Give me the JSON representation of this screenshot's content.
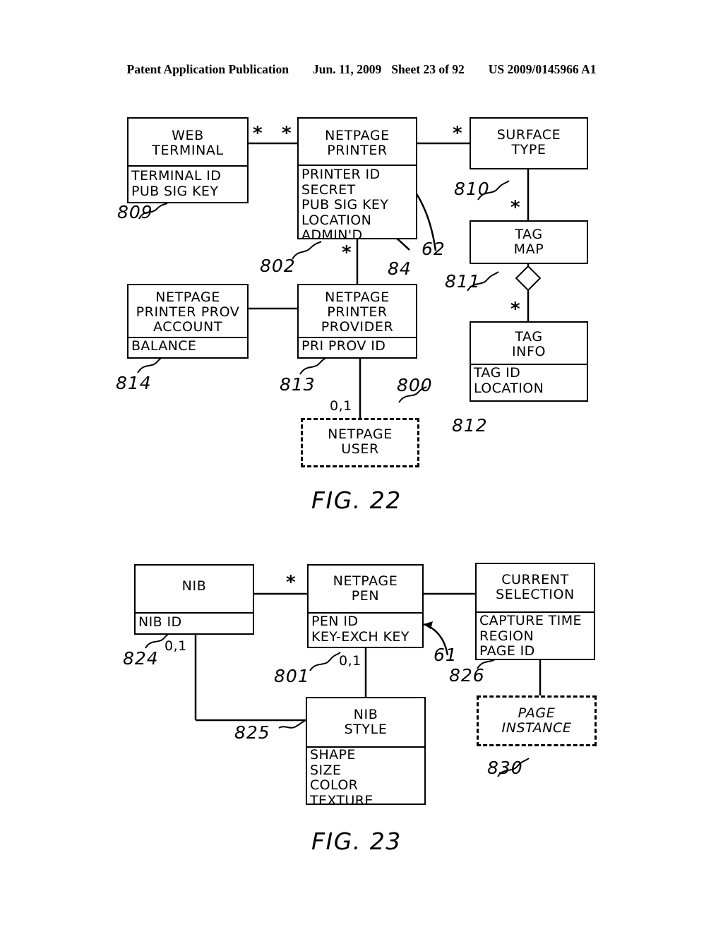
{
  "header": {
    "publication": "Patent Application Publication",
    "date": "Jun. 11, 2009",
    "sheet": "Sheet 23 of 92",
    "docnum": "US 2009/0145966 A1"
  },
  "figures": [
    {
      "caption": "FIG. 22",
      "entities": [
        {
          "id": "web-terminal",
          "title": "WEB\nTERMINAL",
          "attributes": "TERMINAL ID\nPUB SIG KEY",
          "ref": "809",
          "dashed": false
        },
        {
          "id": "netpage-printer",
          "title": "NETPAGE\nPRINTER",
          "attributes": "PRINTER ID\nSECRET\nPUB SIG KEY\nLOCATION\nADMIN'D",
          "ref": "802",
          "dashed": false
        },
        {
          "id": "surface-type",
          "title": "SURFACE\nTYPE",
          "attributes": "",
          "ref": "810",
          "dashed": false
        },
        {
          "id": "tag-map",
          "title": "TAG\nMAP",
          "attributes": "",
          "ref": "811",
          "dashed": false
        },
        {
          "id": "tag-info",
          "title": "TAG\nINFO",
          "attributes": "TAG ID\nLOCATION",
          "ref": "812",
          "dashed": false
        },
        {
          "id": "netpage-printer-prov-account",
          "title": "NETPAGE\nPRINTER PROV\nACCOUNT",
          "attributes": "BALANCE",
          "ref": "814",
          "dashed": false
        },
        {
          "id": "netpage-printer-provider",
          "title": "NETPAGE\nPRINTER\nPROVIDER",
          "attributes": "PRI PROV ID",
          "ref": "813",
          "dashed": false
        },
        {
          "id": "netpage-user",
          "title": "NETPAGE\nUSER",
          "attributes": "",
          "ref": "800",
          "dashed": true
        }
      ],
      "callouts": [
        {
          "id": "callout-62",
          "label": "62"
        },
        {
          "id": "callout-84",
          "label": "84"
        }
      ],
      "multiplicities": [
        {
          "id": "mult-webterminal-printer-left",
          "label": "*"
        },
        {
          "id": "mult-webterminal-printer-right",
          "label": "*"
        },
        {
          "id": "mult-printer-surfacetype",
          "label": "*"
        },
        {
          "id": "mult-surfacetype-tagmap",
          "label": "*"
        },
        {
          "id": "mult-tagmap-taginfo",
          "label": "*"
        },
        {
          "id": "mult-printer-provider",
          "label": "*"
        },
        {
          "id": "mult-provider-user",
          "label": "0,1"
        }
      ]
    },
    {
      "caption": "FIG. 23",
      "entities": [
        {
          "id": "nib",
          "title": "NIB",
          "attributes": "NIB ID",
          "ref": "824",
          "dashed": false
        },
        {
          "id": "netpage-pen",
          "title": "NETPAGE\nPEN",
          "attributes": "PEN ID\nKEY-EXCH KEY",
          "ref": "801",
          "dashed": false
        },
        {
          "id": "current-selection",
          "title": "CURRENT\nSELECTION",
          "attributes": "CAPTURE TIME\nREGION\nPAGE ID",
          "ref": "826",
          "dashed": false
        },
        {
          "id": "nib-style",
          "title": "NIB\nSTYLE",
          "attributes": "SHAPE\nSIZE\nCOLOR\nTEXTURE",
          "ref": "825",
          "dashed": false
        },
        {
          "id": "page-instance",
          "title": "PAGE\nINSTANCE",
          "attributes": "",
          "ref": "830",
          "dashed": true
        }
      ],
      "callouts": [
        {
          "id": "callout-61",
          "label": "61"
        }
      ],
      "multiplicities": [
        {
          "id": "mult-nib-pen",
          "label": "*"
        },
        {
          "id": "mult-nib-style-left",
          "label": "0,1"
        },
        {
          "id": "mult-pen-nibstyle",
          "label": "0,1"
        }
      ]
    }
  ]
}
